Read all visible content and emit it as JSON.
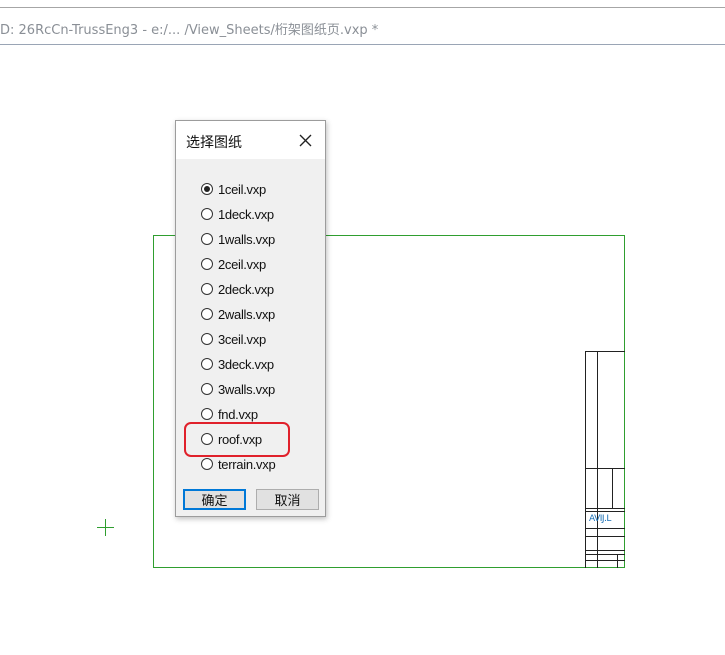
{
  "window": {
    "title_path": "D: 26RcCn-TrussEng3 - e:/... /View_Sheets/桁架图纸页.vxp *"
  },
  "dialog": {
    "title": "选择图纸",
    "close_icon": "close-icon",
    "options": [
      {
        "label": "1ceil.vxp",
        "checked": true
      },
      {
        "label": "1deck.vxp",
        "checked": false
      },
      {
        "label": "1walls.vxp",
        "checked": false
      },
      {
        "label": "2ceil.vxp",
        "checked": false
      },
      {
        "label": "2deck.vxp",
        "checked": false
      },
      {
        "label": "2walls.vxp",
        "checked": false
      },
      {
        "label": "3ceil.vxp",
        "checked": false
      },
      {
        "label": "3deck.vxp",
        "checked": false
      },
      {
        "label": "3walls.vxp",
        "checked": false
      },
      {
        "label": "fnd.vxp",
        "checked": false
      },
      {
        "label": "roof.vxp",
        "checked": false
      },
      {
        "label": "terrain.vxp",
        "checked": false
      }
    ],
    "ok_label": "确定",
    "cancel_label": "取消"
  },
  "drawing": {
    "titleblock_text": "AVIJ.L"
  },
  "colors": {
    "sheet_border": "#2f9e2f",
    "highlight": "#e0212b",
    "ok_focus": "#0078d7"
  }
}
